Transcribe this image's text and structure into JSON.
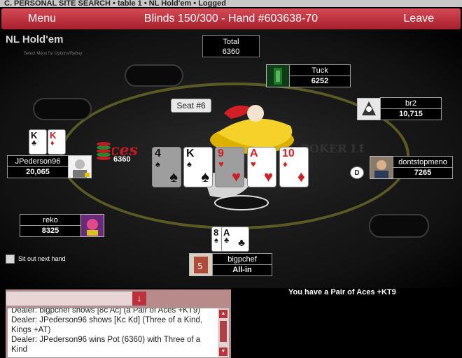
{
  "top_strip": "C. PERSONAL SITE SEARCH • table 1 • NL Hold'em • Logged",
  "topbar": {
    "menu": "Menu",
    "title": "Blinds 150/300 - Hand #603638-70",
    "leave": "Leave"
  },
  "game": {
    "title": "NL Hold'em",
    "hint": "Select Menu for Options/Rebuy"
  },
  "pot": {
    "label": "Total",
    "amount": "6360"
  },
  "seat_tip": "Seat #6",
  "dealer_button": "D",
  "bet": "6360",
  "players": {
    "tuck": {
      "name": "Tuck",
      "stack": "6252"
    },
    "br2": {
      "name": "br2",
      "stack": "10,715"
    },
    "dontstopmeno": {
      "name": "dontstopmeno",
      "stack": "7265"
    },
    "jpederson96": {
      "name": "JPederson96",
      "stack": "20,065"
    },
    "reko": {
      "name": "reko",
      "stack": "8325"
    },
    "bigpchef": {
      "name": "bigpchef",
      "stack": "All-in"
    }
  },
  "board": [
    {
      "rank": "4",
      "suit": "♠",
      "color": "blk",
      "dim": true
    },
    {
      "rank": "K",
      "suit": "♠",
      "color": "blk",
      "dim": false
    },
    {
      "rank": "9",
      "suit": "♥",
      "color": "red",
      "dim": true
    },
    {
      "rank": "A",
      "suit": "♥",
      "color": "red",
      "dim": false
    },
    {
      "rank": "10",
      "suit": "♦",
      "color": "red",
      "dim": false
    }
  ],
  "jp_cards": [
    {
      "rank": "K",
      "suit": "♣"
    },
    {
      "rank": "K",
      "suit": "♦"
    }
  ],
  "hero_cards": [
    {
      "rank": "8",
      "suit": "♠"
    },
    {
      "rank": "A",
      "suit": "♣"
    }
  ],
  "sitout_label": "Sit out next hand",
  "hand_message": "You have a Pair of Aces +KT9",
  "chat": [
    "Dealer: bigpchef shows [8c Ac] (a Pair of Aces +KT9)",
    "Dealer: JPederson96 shows [Kc Kd] (Three of a Kind, Kings +AT)",
    "Dealer: JPederson96 wins Pot (6360) with Three of a Kind"
  ],
  "colors": {
    "topbar": "#b8283a",
    "felt_rim": "#5b5a22",
    "background": "#000000"
  }
}
